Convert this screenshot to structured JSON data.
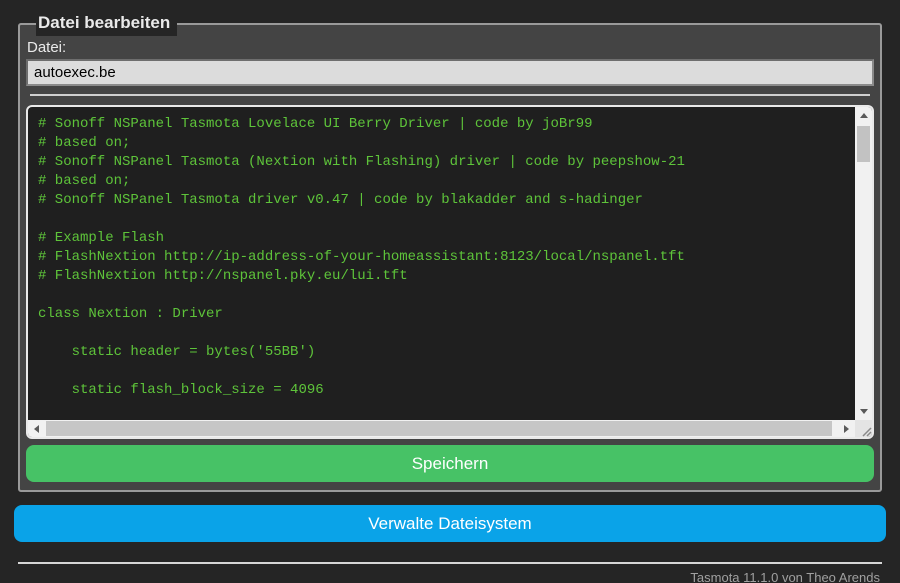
{
  "page": {
    "footer_text": "Tasmota 11.1.0 von Theo Arends"
  },
  "file_editor": {
    "legend": "Datei bearbeiten",
    "file_label": "Datei:",
    "filename_value": "autoexec.be",
    "save_button_label": "Speichern"
  },
  "editor_content": "# Sonoff NSPanel Tasmota Lovelace UI Berry Driver | code by joBr99\n# based on;\n# Sonoff NSPanel Tasmota (Nextion with Flashing) driver | code by peepshow-21\n# based on;\n# Sonoff NSPanel Tasmota driver v0.47 | code by blakadder and s-hadinger\n\n# Example Flash\n# FlashNextion http://ip-address-of-your-homeassistant:8123/local/nspanel.tft\n# FlashNextion http://nspanel.pky.eu/lui.tft\n\nclass Nextion : Driver\n\n    static header = bytes('55BB')\n\n    static flash_block_size = 4096",
  "manage_fs_button_label": "Verwalte Dateisystem",
  "icons": {
    "scroll_up": "triangle-up",
    "scroll_down": "triangle-down",
    "scroll_left": "triangle-left",
    "scroll_right": "triangle-right",
    "resize_grip": "diagonal-grip"
  },
  "colors": {
    "page_bg": "#252525",
    "form_bg": "#444444",
    "text": "#eaeaea",
    "input_bg": "#dcdcdc",
    "input_text": "#000000",
    "console_bg": "#1f1f1f",
    "console_text": "#5ec43a",
    "save_button": "#47c266",
    "manage_button": "#0aa3e8",
    "footer_text": "#a0a0a0"
  }
}
